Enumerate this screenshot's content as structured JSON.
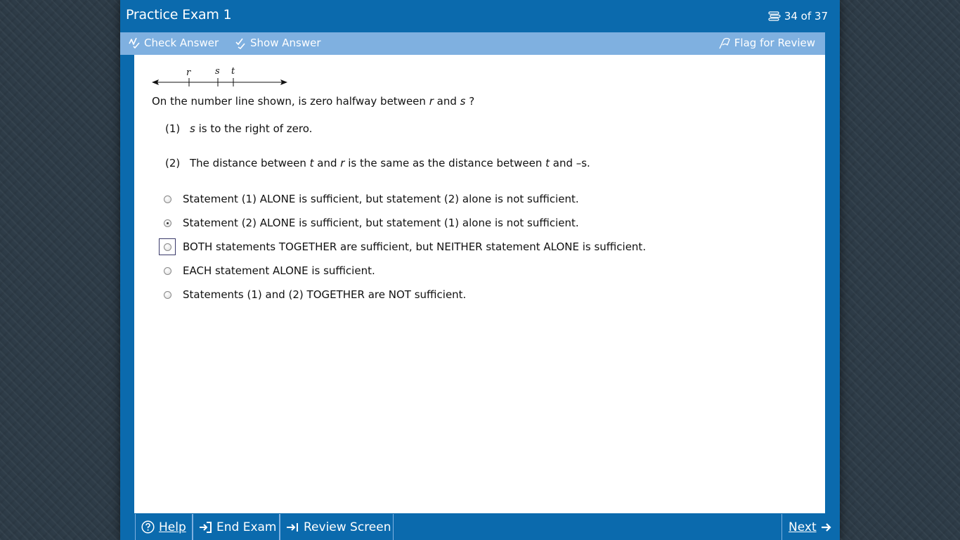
{
  "header": {
    "title": "Practice Exam 1",
    "progress": "34 of 37",
    "progress_icon": "stack-icon"
  },
  "toolbar": {
    "check_answer": "Check Answer",
    "show_answer": "Show Answer",
    "flag_review": "Flag for Review"
  },
  "number_line": {
    "labels": [
      "r",
      "s",
      "t"
    ]
  },
  "question": {
    "before_r": "On the number line shown, is zero halfway between ",
    "var_r": "r",
    "and": " and ",
    "var_s": "s",
    "end": " ?"
  },
  "statements": [
    {
      "num": "(1)",
      "var": "s",
      "text": " is to the right of zero."
    },
    {
      "num": "(2)",
      "pre": "The distance between ",
      "var_t1": "t",
      "mid1": " and ",
      "var_r": "r",
      "mid2": " is the same as the distance between ",
      "var_t2": "t",
      "end": " and –s."
    }
  ],
  "options": [
    {
      "label": "Statement (1) ALONE is sufficient, but statement (2) alone is not sufficient.",
      "selected": false
    },
    {
      "label": "Statement (2) ALONE is sufficient, but statement (1) alone is not sufficient.",
      "selected": true
    },
    {
      "label": "BOTH statements TOGETHER are sufficient, but NEITHER statement ALONE is sufficient.",
      "selected": false
    },
    {
      "label": "EACH statement ALONE is sufficient.",
      "selected": false
    },
    {
      "label": "Statements (1) and (2) TOGETHER are NOT sufficient.",
      "selected": false
    }
  ],
  "bottom": {
    "help": "Help",
    "end_exam": "End Exam",
    "review_screen": "Review Screen",
    "next": "Next"
  },
  "colors": {
    "frame": "#0b6aad",
    "toolbar": "#7fb0e0",
    "content": "#ffffff"
  }
}
